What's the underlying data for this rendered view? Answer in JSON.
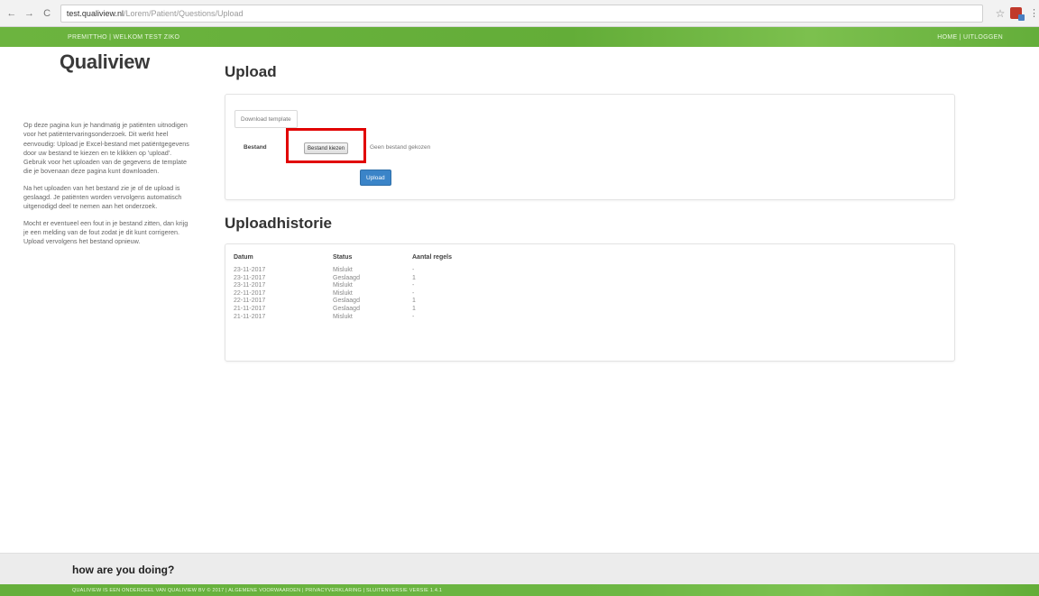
{
  "browser": {
    "back_icon": "←",
    "forward_icon": "→",
    "reload_icon": "C",
    "url_host": "test.qualiview.nl",
    "url_path": "/Lorem/Patient/Questions/Upload",
    "star_icon": "☆",
    "menu_icon": "⋮"
  },
  "topbar": {
    "left": "PREMITTHO | WELKOM TEST ZIKO",
    "right": "HOME | UITLOGGEN"
  },
  "sidebar": {
    "logo": "Qualiview",
    "paragraphs": [
      "Op deze pagina kun je handmatig je patiënten uitnodigen voor het patiëntervaringsonderzoek. Dit werkt heel eenvoudig: Upload je Excel-bestand met patiëntgegevens door uw bestand te kiezen en te klikken op 'upload'. Gebruik voor het uploaden van de gegevens de template die je bovenaan deze pagina kunt downloaden.",
      "Na het uploaden van het bestand zie je of de upload is geslaagd. Je patiënten worden vervolgens automatisch uitgenodigd deel te nemen aan het onderzoek.",
      "Mocht er eventueel een fout in je bestand zitten, dan krijg je een melding van de fout zodat je dit kunt corrigeren. Upload vervolgens het bestand opnieuw."
    ]
  },
  "upload": {
    "title": "Upload",
    "download_template": "Download template",
    "file_label": "Bestand",
    "choose_file": "Bestand kiezen",
    "no_file": "Geen bestand gekozen",
    "upload_button": "Upload"
  },
  "history": {
    "title": "Uploadhistorie",
    "columns": [
      "Datum",
      "Status",
      "Aantal regels"
    ],
    "rows": [
      [
        "23-11-2017",
        "Mislukt",
        "-"
      ],
      [
        "23-11-2017",
        "Geslaagd",
        "1"
      ],
      [
        "23-11-2017",
        "Mislukt",
        "-"
      ],
      [
        "22-11-2017",
        "Mislukt",
        "-"
      ],
      [
        "22-11-2017",
        "Geslaagd",
        "1"
      ],
      [
        "21-11-2017",
        "Geslaagd",
        "1"
      ],
      [
        "21-11-2017",
        "Mislukt",
        "-"
      ]
    ]
  },
  "footer": {
    "tagline": "how are you doing?",
    "bottom": "QUALIVIEW IS EEN ONDERDEEL VAN QUALIVIEW BV © 2017 | ALGEMENE VOORWAARDEN | PRIVACYVERKLARING | SLUITENVERSIE VERSIE 1.4.1"
  },
  "colors": {
    "brand_green": "#6cb43f",
    "primary_blue": "#3a84c8",
    "highlight_red": "#e10000"
  }
}
